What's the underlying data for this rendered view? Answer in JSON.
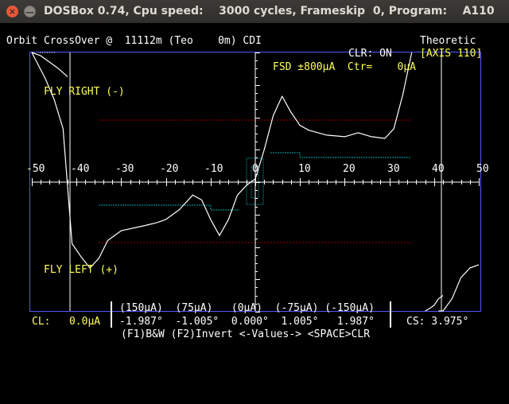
{
  "window": {
    "title": "DOSBox 0.74, Cpu speed:    3000 cycles, Frameskip  0, Program:    A110",
    "close_glyph": "×",
    "minimize_glyph": "—"
  },
  "header": {
    "left": "Orbit CrossOver @  11112m (Teo    0m) CDI",
    "right": "Theoretic",
    "clr_status": "CLR: ON",
    "axis": "[AXIS 110]",
    "fsd": "FSD ±800µA  Ctr=    0µA"
  },
  "plot": {
    "fly_right": "FLY RIGHT (-)",
    "fly_left": "FLY LEFT (+)",
    "tick_labels": [
      "-50",
      "-40",
      "-30",
      "-20",
      "-10",
      "0",
      "10",
      "20",
      "30",
      "40",
      "50"
    ]
  },
  "footer": {
    "cl_label": "CL:   0.0µA",
    "values_row1": "(150µA)  (75µA)   (0µA)  (-75µA) (-150µA)",
    "values_row2": "-1.987°  -1.005°  0.000°  1.005°   1.987°",
    "cs_label": "CS: 3.975°",
    "keys": "(F1)B&W (F2)Invert <-Values-> <SPACE>CLR"
  },
  "colors": {
    "text": "#ffffff",
    "highlight": "#ffff55",
    "frame": "#5555ff",
    "reference": "#aa0000",
    "bar": "#00aaaa"
  },
  "chart_data": {
    "type": "line",
    "x_range": [
      -50,
      50
    ],
    "y_range_uA": [
      800,
      -800
    ],
    "grid": false,
    "series": [
      {
        "x": [
          -50,
          -47,
          -45,
          -43,
          -41,
          -39,
          -37,
          -35,
          -33,
          -30,
          -25,
          -22,
          -20,
          -17,
          -14,
          -12,
          -10,
          -8,
          -6,
          -4,
          -2,
          0,
          2,
          4,
          6,
          8,
          10,
          12,
          16,
          20,
          23,
          26,
          29,
          31,
          33,
          35
        ],
        "y": [
          860,
          640,
          510,
          330,
          -380,
          -460,
          -530,
          -470,
          -360,
          -300,
          -270,
          -250,
          -230,
          -170,
          -80,
          -110,
          -230,
          -330,
          -230,
          -80,
          -20,
          20,
          200,
          410,
          530,
          430,
          350,
          320,
          290,
          280,
          305,
          280,
          270,
          330,
          540,
          900
        ]
      },
      {
        "x": [
          -50,
          -48,
          -46,
          -44,
          -42
        ],
        "y": [
          900,
          780,
          740,
          700,
          650
        ]
      },
      {
        "x": [
          38,
          39,
          40,
          41,
          42
        ],
        "y": [
          -900,
          -780,
          -760,
          -720,
          -700
        ]
      },
      {
        "x": [
          41,
          42,
          44,
          46,
          48,
          50
        ],
        "y": [
          -900,
          -870,
          -720,
          -590,
          -530,
          -510
        ]
      }
    ]
  }
}
